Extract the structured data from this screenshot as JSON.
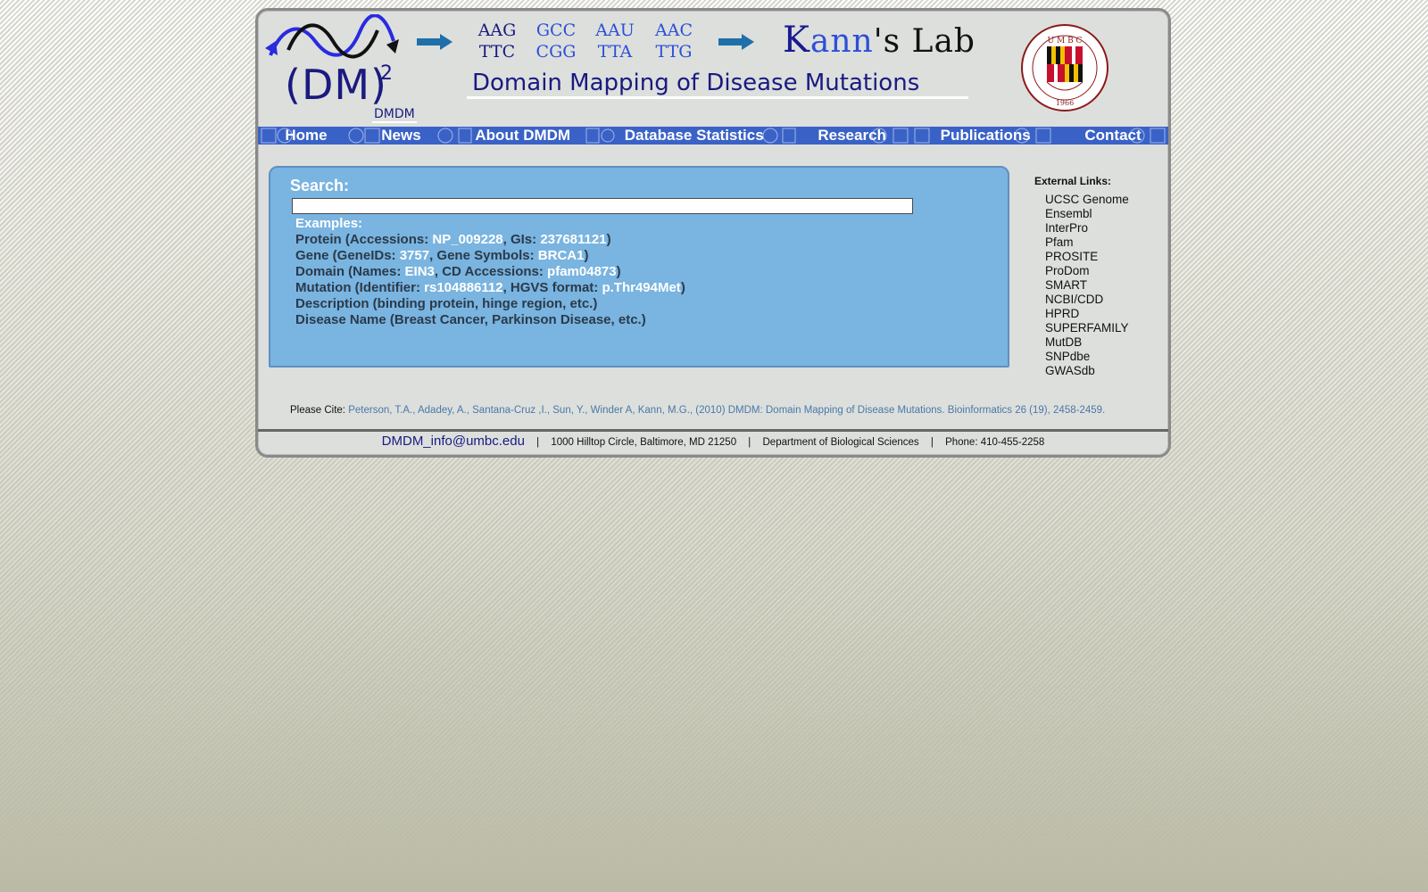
{
  "header": {
    "logo": {
      "main": "(DM)",
      "sup": "2",
      "sub": "DMDM"
    },
    "codons": [
      {
        "top": "AAG",
        "bottom": "TTC",
        "color": "#1a1a80"
      },
      {
        "top": "GCC",
        "bottom": "CGG",
        "color": "#2d4fd8"
      },
      {
        "top": "AAU",
        "bottom": "TTA",
        "color": "#2d4fd8"
      },
      {
        "top": "AAC",
        "bottom": "TTG",
        "color": "#2d4fd8"
      }
    ],
    "lab_name_k": "K",
    "lab_name_ann": "ann",
    "lab_name_rest": "'s Lab",
    "subtitle": "Domain Mapping of Disease Mutations",
    "seal_icon": "umbc-seal-icon"
  },
  "nav": {
    "items": [
      {
        "label": "Home"
      },
      {
        "label": "News"
      },
      {
        "label": "About DMDM"
      },
      {
        "label": "Database Statistics"
      },
      {
        "label": "Research"
      },
      {
        "label": "Publications"
      },
      {
        "label": "Contact"
      }
    ]
  },
  "search": {
    "label": "Search:",
    "input_value": "",
    "examples_heading": "Examples:",
    "protein_prefix": "Protein (Accessions: ",
    "protein_acc": "NP_009228",
    "protein_mid": ", GIs: ",
    "protein_gi": "237681121",
    "close": ")",
    "gene_prefix": "Gene (GeneIDs: ",
    "gene_id": "3757",
    "gene_mid": ", Gene Symbols: ",
    "gene_symbol": "BRCA1",
    "domain_prefix": "Domain (Names: ",
    "domain_name": "EIN3",
    "domain_mid": ", CD Accessions: ",
    "domain_cd": "pfam04873",
    "mutation_prefix": "Mutation (Identifier: ",
    "mutation_id": "rs104886112",
    "mutation_mid": ", HGVS format: ",
    "mutation_hgvs": "p.Thr494Met",
    "description": "Description (binding protein, hinge region, etc.)",
    "disease": "Disease Name (Breast Cancer, Parkinson Disease, etc.)"
  },
  "external_links": {
    "title": "External Links:",
    "items": [
      "UCSC Genome",
      "Ensembl",
      "InterPro",
      "Pfam",
      "PROSITE",
      "ProDom",
      "SMART",
      "NCBI/CDD",
      "HPRD",
      "SUPERFAMILY",
      "MutDB",
      "SNPdbe",
      "GWASdb"
    ]
  },
  "cite": {
    "label": "Please Cite: ",
    "text": "Peterson, T.A., Adadey, A., Santana-Cruz ,I., Sun, Y., Winder A, Kann, M.G., (2010) DMDM: Domain Mapping of Disease Mutations. Bioinformatics 26 (19), 2458-2459."
  },
  "footer": {
    "email": "DMDM_info@umbc.edu",
    "address": "1000 Hilltop Circle, Baltimore, MD 21250",
    "department": "Department of Biological Sciences",
    "phone": "Phone: 410-455-2258",
    "separator": "|"
  },
  "colors": {
    "nav_bg": "#3a62c6",
    "panel_bg": "#7ab4e0",
    "text_dark_blue": "#1a1a80",
    "link_blue": "#4b78a8"
  }
}
